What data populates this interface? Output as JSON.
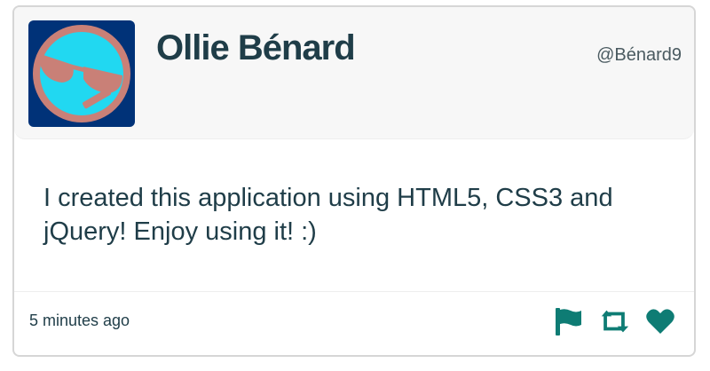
{
  "tweet": {
    "author_name": "Ollie Bénard",
    "handle": "@Bénard9",
    "text": "I created this application using HTML5, CSS3 and jQuery! Enjoy using it! :)",
    "timestamp": "5 minutes ago"
  },
  "actions": [
    {
      "icon": "flag-icon",
      "action": "flag"
    },
    {
      "icon": "retweet-icon",
      "action": "retweet"
    },
    {
      "icon": "heart-icon",
      "action": "like"
    }
  ],
  "colors": {
    "accent": "#0e7c74",
    "text": "#1f3d48",
    "avatar_background": "#003278",
    "avatar_ring": "#c98077",
    "avatar_face": "#21d8f1"
  }
}
